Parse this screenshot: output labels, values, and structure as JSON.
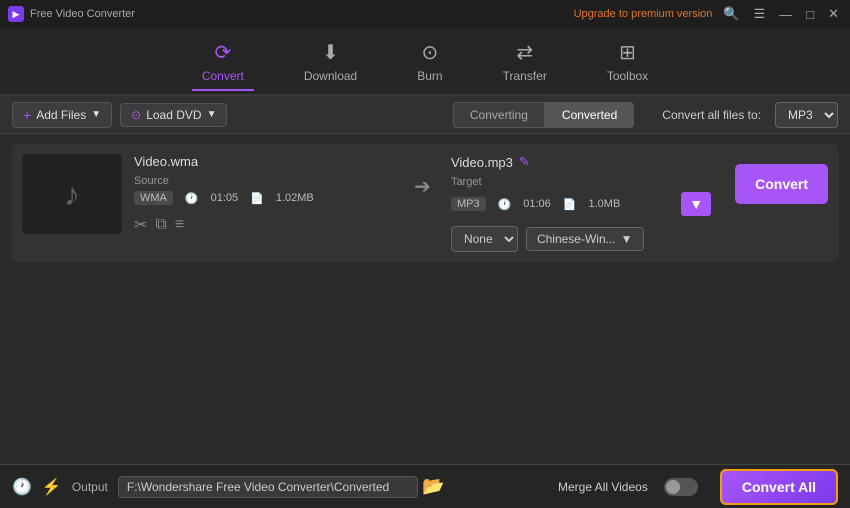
{
  "app": {
    "title": "Free Video Converter",
    "upgrade_text": "Upgrade to premium version"
  },
  "titlebar": {
    "search_icon": "🔍",
    "menu_icon": "☰",
    "minimize_icon": "—",
    "maximize_icon": "□",
    "close_icon": "✕"
  },
  "nav": {
    "items": [
      {
        "id": "convert",
        "label": "Convert",
        "active": true
      },
      {
        "id": "download",
        "label": "Download",
        "active": false
      },
      {
        "id": "burn",
        "label": "Burn",
        "active": false
      },
      {
        "id": "transfer",
        "label": "Transfer",
        "active": false
      },
      {
        "id": "toolbox",
        "label": "Toolbox",
        "active": false
      }
    ]
  },
  "toolbar": {
    "add_files_label": "Add Files",
    "load_dvd_label": "Load DVD",
    "tab_converting": "Converting",
    "tab_converted": "Converted",
    "convert_all_files_label": "Convert all files to:",
    "format_value": "MP3"
  },
  "file_item": {
    "source_filename": "Video.wma",
    "target_filename": "Video.mp3",
    "source_label": "Source",
    "target_label": "Target",
    "source_format": "WMA",
    "source_duration": "01:05",
    "source_size": "1.02MB",
    "target_format": "MP3",
    "target_duration": "01:06",
    "target_size": "1.0MB",
    "subtitle_none": "None",
    "subtitle_lang": "Chinese-Win...",
    "convert_btn_label": "Convert"
  },
  "bottom_bar": {
    "output_label": "Output",
    "output_path": "F:\\Wondershare Free Video Converter\\Converted",
    "merge_label": "Merge All Videos",
    "convert_all_label": "Convert All"
  }
}
